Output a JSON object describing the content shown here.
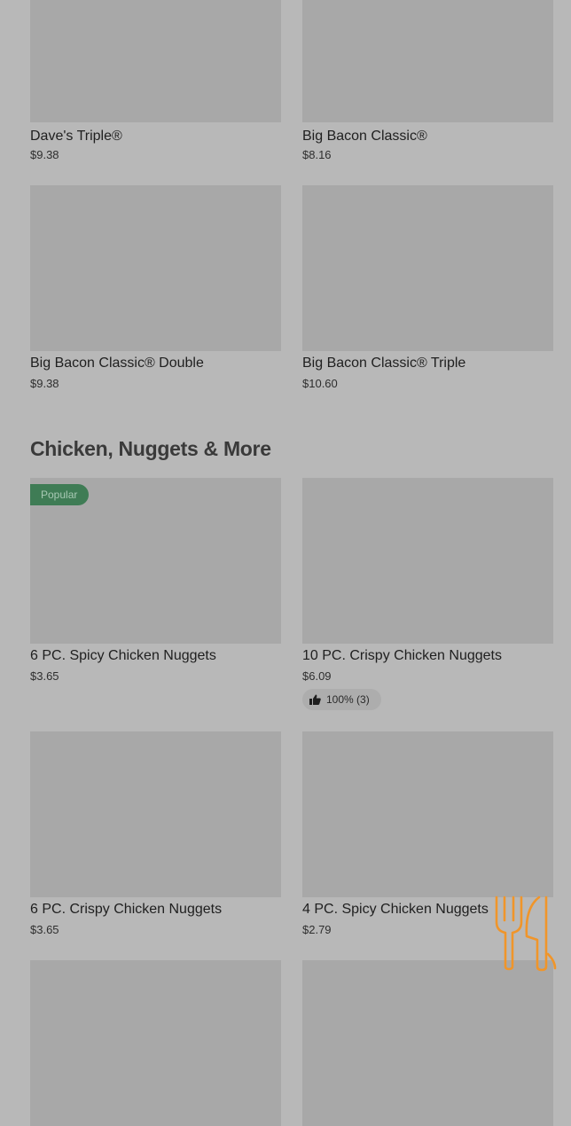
{
  "sections": {
    "burgers": {
      "items": [
        {
          "name": "Dave's Triple®",
          "price": "$9.38"
        },
        {
          "name": "Big Bacon Classic®",
          "price": "$8.16"
        },
        {
          "name": "Big Bacon Classic® Double",
          "price": "$9.38"
        },
        {
          "name": "Big Bacon Classic® Triple",
          "price": "$10.60"
        }
      ]
    },
    "chicken": {
      "title": "Chicken, Nuggets & More",
      "items": [
        {
          "name": "6 PC. Spicy Chicken Nuggets",
          "price": "$3.65",
          "badge": "Popular"
        },
        {
          "name": "10 PC. Crispy Chicken Nuggets",
          "price": "$6.09",
          "rating": "100% (3)"
        },
        {
          "name": "6 PC. Crispy Chicken Nuggets",
          "price": "$3.65"
        },
        {
          "name": "4 PC. Spicy Chicken Nuggets",
          "price": "$2.79"
        }
      ]
    }
  },
  "icons": {
    "rating": "thumbs-up-icon",
    "floating_button": "utensils-icon"
  },
  "colors": {
    "popular_badge": "#3f7c55",
    "utensils_accent": "#f0952a"
  }
}
